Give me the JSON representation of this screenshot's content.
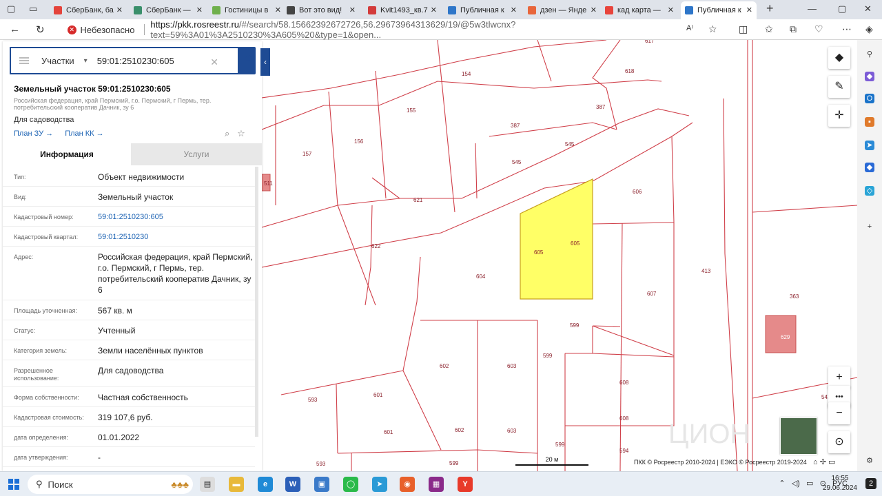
{
  "browser": {
    "tabs": [
      {
        "label": "СберБанк, ба",
        "color": "#e4433b"
      },
      {
        "label": "СберБанк —",
        "color": "#3a8f6b"
      },
      {
        "label": "Гостиницы в",
        "color": "#6fb04c"
      },
      {
        "label": "Вот это вид!",
        "color": "#444444"
      },
      {
        "label": "Kvit1493_кв.7",
        "color": "#d33b3b"
      },
      {
        "label": "Публичная к",
        "color": "#2e76c9"
      },
      {
        "label": "дзен — Янде",
        "color": "#e8663b"
      },
      {
        "label": "кад карта —",
        "color": "#e8443b"
      },
      {
        "label": "Публичная к",
        "color": "#2e76c9"
      }
    ],
    "new_tab_icon": "plus-icon",
    "window_controls": [
      "minimize-icon",
      "maximize-icon",
      "close-icon"
    ],
    "address": {
      "insecure_label": "Небезопасно",
      "url_domain": "https://pkk.rosreestr.ru",
      "url_rest": "/#/search/58.15662392672726,56.29673964313629/19/@5w3tlwcnx?text=59%3A01%3A2510230%3A605%20&type=1&open..."
    }
  },
  "panel": {
    "search": {
      "type_label": "Участки",
      "value": "59:01:2510230:605"
    },
    "title": "Земельный участок 59:01:2510230:605",
    "address_short": "Российская федерация, край Пермский, г.о. Пермский, г Пермь, тер. потребительский кооператив Дачник, зу 6",
    "use": "Для садоводства",
    "plan_zu": "План ЗУ →",
    "plan_kk": "План КК →",
    "tab_info": "Информация",
    "tab_services": "Услуги",
    "rows": [
      {
        "k": "Тип:",
        "v": "Объект недвижимости",
        "link": false
      },
      {
        "k": "Вид:",
        "v": "Земельный участок",
        "link": false
      },
      {
        "k": "Кадастровый номер:",
        "v": "59:01:2510230:605",
        "link": true
      },
      {
        "k": "Кадастровый квартал:",
        "v": "59:01:2510230",
        "link": true
      },
      {
        "k": "Адрес:",
        "v": "Российская федерация, край Пермский, г.о. Пермский, г Пермь, тер. потребительский кооператив Дачник, зу 6",
        "link": false
      },
      {
        "k": "Площадь уточненная:",
        "v": "567 кв. м",
        "link": false
      },
      {
        "k": "Статус:",
        "v": "Учтенный",
        "link": false
      },
      {
        "k": "Категория земель:",
        "v": "Земли населённых пунктов",
        "link": false
      },
      {
        "k": "Разрешенное использование:",
        "v": "Для садоводства",
        "link": false
      },
      {
        "k": "Форма собственности:",
        "v": "Частная собственность",
        "link": false
      },
      {
        "k": "Кадастровая стоимость:",
        "v": "319 107,6 руб.",
        "link": false
      },
      {
        "k": "дата определения:",
        "v": "01.01.2022",
        "link": false
      },
      {
        "k": "дата утверждения:",
        "v": "-",
        "link": false
      }
    ]
  },
  "map": {
    "parcel_labels": [
      "154",
      "618",
      "155",
      "387",
      "387",
      "545",
      "545",
      "157",
      "156",
      "621",
      "606",
      "622",
      "605",
      "605",
      "604",
      "413",
      "607",
      "363",
      "599",
      "599",
      "629",
      "602",
      "603",
      "608",
      "593",
      "601",
      "601",
      "602",
      "603",
      "608",
      "541",
      "599",
      "594",
      "593",
      "599",
      "617",
      "511"
    ],
    "scale_label": "20 м",
    "copyright": "ПКК © Росреестр 2010-2024 | ЕЭКО © Росреестр 2019-2024",
    "watermark": "ЦИОН",
    "highlight_color": "#ffff66",
    "border_color": "#d0404a"
  },
  "taskbar": {
    "search_label": "Поиск",
    "lang": "РУС",
    "time": "16:55",
    "date": "29.06.2024",
    "notifications": "2"
  }
}
